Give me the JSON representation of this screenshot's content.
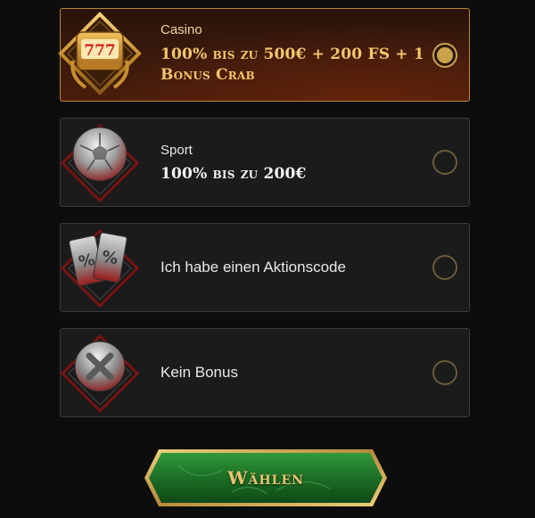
{
  "options": [
    {
      "category": "Casino",
      "title": "100% bis zu 500€ + 200 FS + 1 Bonus Crab",
      "selected": true,
      "icon": "slot-777-icon"
    },
    {
      "category": "Sport",
      "title": "100% bis zu 200€",
      "selected": false,
      "icon": "soccer-ball-icon"
    },
    {
      "label": "Ich habe einen Aktionscode",
      "selected": false,
      "icon": "promo-code-icon"
    },
    {
      "label": "Kein Bonus",
      "selected": false,
      "icon": "no-bonus-icon"
    }
  ],
  "submit": {
    "label": "Wählen"
  },
  "colors": {
    "background": "#0d0d0d",
    "card": "#1b1b1b",
    "card_border": "#3a3a3a",
    "selected_border": "#b8893b",
    "gold_text": "#f3c66b",
    "radio_dot": "#c9a24a",
    "button_green": "#1f7a2a"
  }
}
